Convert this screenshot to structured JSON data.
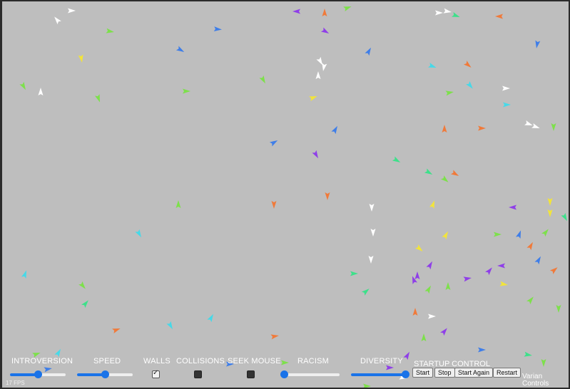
{
  "colors": {
    "background": "#bebebe",
    "accent": "#1a73e8",
    "boid_palette": {
      "w": "#ffffff",
      "o": "#f07a3a",
      "g": "#7de04b",
      "t": "#3de08a",
      "c": "#46d9e8",
      "b": "#3f7ee8",
      "p": "#8f3fe8",
      "y": "#f2e43a"
    }
  },
  "controls": {
    "introversion": {
      "label": "INTROVERSION",
      "value": 0.5
    },
    "speed": {
      "label": "SPEED",
      "value": 0.5
    },
    "walls": {
      "label": "WALLS",
      "checked": true
    },
    "collisions": {
      "label": "COLLISIONS",
      "checked": false
    },
    "seek_mouse": {
      "label": "SEEK MOUSE",
      "checked": false
    },
    "racism": {
      "label": "RACISM",
      "value": 0.0
    },
    "diversity": {
      "label": "DIVERSITY",
      "value": 1.0
    }
  },
  "startup": {
    "label": "STARTUP CONTROL",
    "buttons": {
      "start": "Start",
      "stop": "Stop",
      "start_again": "Start Again",
      "restart": "Restart"
    }
  },
  "variant_label": "Varian Controls",
  "fps": "17 FPS"
}
